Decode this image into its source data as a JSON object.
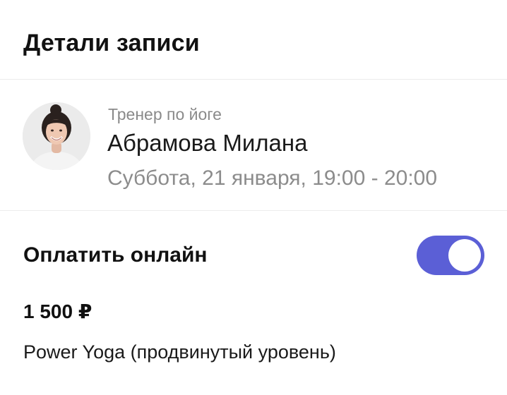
{
  "header": {
    "title": "Детали записи"
  },
  "trainer": {
    "role": "Тренер по йоге",
    "name": "Абрамова Милана",
    "schedule": "Суббота, 21 января, 19:00 - 20:00"
  },
  "payment": {
    "label": "Оплатить онлайн",
    "toggle_on": true,
    "toggle_color": "#5b5fd6",
    "price": "1 500 ₽",
    "class_name": "Power Yoga (продвинутый уровень)"
  }
}
